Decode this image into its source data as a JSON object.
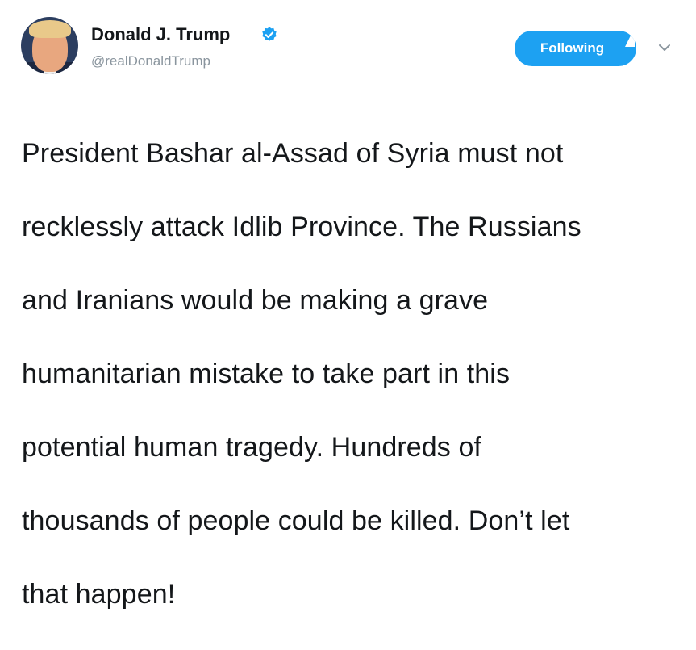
{
  "tweet": {
    "author": {
      "name": "Donald J. Trump",
      "handle": "@realDonaldTrump",
      "verified": true
    },
    "follow_button_label": "Following",
    "text_lines": [
      "President Bashar al-Assad of Syria must not",
      "recklessly attack Idlib Province. The Russians",
      "and Iranians would be making a grave",
      "humanitarian mistake to take part in this",
      "potential human tragedy. Hundreds of",
      "thousands of people could be killed. Don’t let",
      "that happen!"
    ]
  },
  "colors": {
    "accent": "#1da1f2",
    "text": "#14171a",
    "muted": "#8a959e"
  },
  "icons": {
    "verified": "verified-badge-icon",
    "menu": "chevron-down-icon"
  }
}
